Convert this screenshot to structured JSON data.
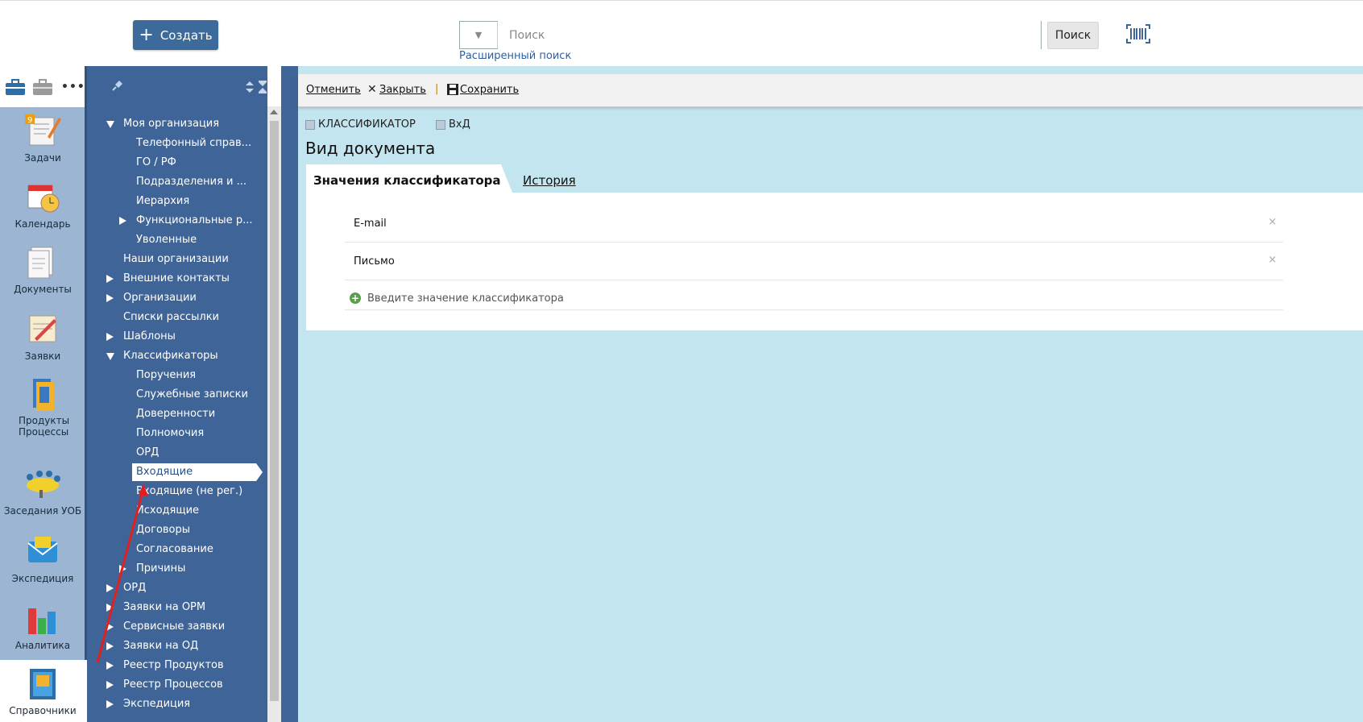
{
  "header": {
    "create_label": "Создать",
    "search_placeholder": "Поиск",
    "search_button": "Поиск",
    "advanced_search": "Расширенный поиск"
  },
  "left_nav": {
    "items": [
      {
        "label": "Задачи",
        "badge": "9"
      },
      {
        "label": "Календарь"
      },
      {
        "label": "Документы"
      },
      {
        "label": "Заявки"
      },
      {
        "label": "Продукты Процессы"
      },
      {
        "label": "Заседания УОБ"
      },
      {
        "label": "Экспедиция"
      },
      {
        "label": "Аналитика"
      },
      {
        "label": "Справочники",
        "active": true
      }
    ]
  },
  "tree": {
    "items": [
      {
        "label": "Моя организация",
        "expanded": true
      },
      {
        "label": "Телефонный справ..."
      },
      {
        "label": "ГО / РФ"
      },
      {
        "label": "Подразделения и ..."
      },
      {
        "label": "Иерархия"
      },
      {
        "label": "Функциональные р..."
      },
      {
        "label": "Уволенные"
      },
      {
        "label": "Наши организации"
      },
      {
        "label": "Внешние контакты"
      },
      {
        "label": "Организации"
      },
      {
        "label": "Списки рассылки"
      },
      {
        "label": "Шаблоны"
      },
      {
        "label": "Классификаторы",
        "expanded": true
      },
      {
        "label": "Поручения"
      },
      {
        "label": "Служебные записки"
      },
      {
        "label": "Доверенности"
      },
      {
        "label": "Полномочия"
      },
      {
        "label": "ОРД"
      },
      {
        "label": "Входящие",
        "selected": true
      },
      {
        "label": "Входящие (не рег.)"
      },
      {
        "label": "Исходящие"
      },
      {
        "label": "Договоры"
      },
      {
        "label": "Согласование"
      },
      {
        "label": "Причины"
      },
      {
        "label": "ОРД"
      },
      {
        "label": "Заявки на ОРМ"
      },
      {
        "label": "Сервисные заявки"
      },
      {
        "label": "Заявки на ОД"
      },
      {
        "label": "Реестр Продуктов"
      },
      {
        "label": "Реестр Процессов"
      },
      {
        "label": "Экспедиция"
      }
    ]
  },
  "toolbar": {
    "cancel": "Отменить",
    "close": "Закрыть",
    "separator": "|",
    "save": "Сохранить"
  },
  "breadcrumb": {
    "first": "КЛАССИФИКАТОР",
    "second": "ВхД"
  },
  "page": {
    "title": "Вид документа",
    "tab_active": "Значения классификатора",
    "tab_history": "История",
    "values": [
      "E-mail",
      "Письмо"
    ],
    "add_placeholder": "Введите значение классификатора",
    "remove_glyph": "×"
  },
  "colors": {
    "accent": "#3f6598",
    "main_bg": "#c3e5ef",
    "left_strip": "#9bb5d3",
    "arrow": "#e02020"
  }
}
